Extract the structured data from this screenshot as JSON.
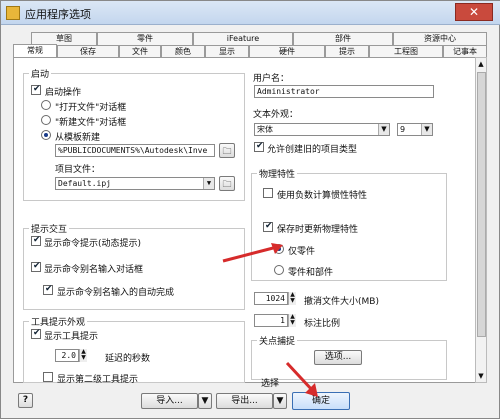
{
  "window": {
    "title": "应用程序选项",
    "close": "✕"
  },
  "tabs_row1": [
    "草图",
    "零件",
    "iFeature",
    "部件",
    "资源中心"
  ],
  "tabs_row2": [
    "常规",
    "保存",
    "文件",
    "颜色",
    "显示",
    "硬件",
    "提示",
    "工程图",
    "记事本"
  ],
  "startup": {
    "legend": "启动",
    "startup_action": "启动操作",
    "open_file": "\"打开文件\"对话框",
    "new_file": "\"新建文件\"对话框",
    "from_template": "从模板新建",
    "template_path": "%PUBLICDOCUMENTS%\\Autodesk\\Inve",
    "project_file_label": "项目文件：",
    "project_file": "Default.ipj"
  },
  "prompt_interaction": {
    "legend": "提示交互",
    "show_command_prompt": "显示命令提示(动态提示)",
    "show_alias_input": "显示命令别名输入对话框",
    "show_alias_autocomplete": "显示命令别名输入的自动完成"
  },
  "tooltip": {
    "legend": "工具提示外观",
    "show_tooltips": "显示工具提示",
    "delay_value": "2.0",
    "delay_label": "延迟的秒数",
    "show_second_level": "显示第二级工具提示"
  },
  "user": {
    "label": "用户名：",
    "value": "Administrator"
  },
  "text_appearance": {
    "label": "文本外观：",
    "font": "宋体",
    "size": "9",
    "allow_types": "允许创建旧的项目类型"
  },
  "physical": {
    "legend": "物理特性",
    "use_density": "使用负数计算惯性特性",
    "update_on_save": "保存时更新物理特性",
    "parts_only": "仅零件",
    "parts_and_assemblies": "零件和部件"
  },
  "undo": {
    "value": "1024",
    "label": "撤消文件大小(MB)"
  },
  "annotation": {
    "value": "1",
    "label": "标注比例"
  },
  "selection": {
    "legend": "关点捕捉",
    "options_button": "选项...",
    "extra_legend": "选择"
  },
  "footer": {
    "help": "?",
    "import": "导入...",
    "export": "导出...",
    "ok": "确定"
  }
}
